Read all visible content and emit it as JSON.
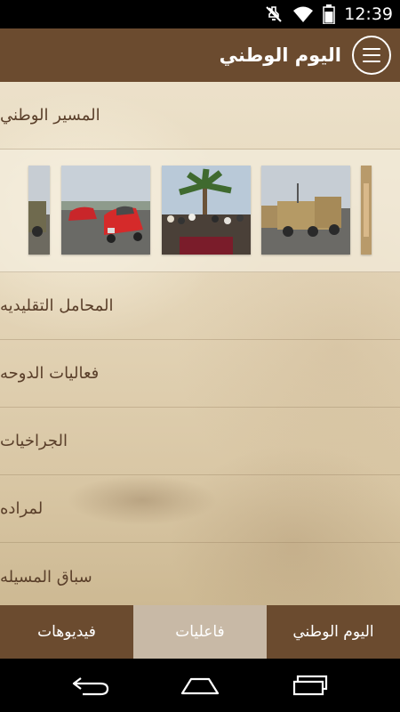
{
  "status_bar": {
    "time": "12:39",
    "icons": [
      "mute-icon",
      "wifi-icon",
      "battery-icon"
    ]
  },
  "app_bar": {
    "title": "اليوم الوطني",
    "menu_icon": "hamburger-menu-icon"
  },
  "list": {
    "items": [
      {
        "label": "المسير الوطني"
      },
      {
        "label": "المحامل التقليديه"
      },
      {
        "label": "فعاليات الدوحه"
      },
      {
        "label": "الجراخيات"
      },
      {
        "label": "لمراده"
      },
      {
        "label": "سباق المسيله"
      }
    ]
  },
  "gallery": {
    "images": [
      "military-vehicle-photo",
      "red-cars-photo",
      "crowd-palm-photo",
      "parade-vehicles-photo",
      "building-photo"
    ]
  },
  "tabs": [
    {
      "label": "فيديوهات",
      "active": false
    },
    {
      "label": "فاعليات",
      "active": true
    },
    {
      "label": "اليوم الوطني",
      "active": false
    }
  ],
  "nav_bar": {
    "icons": [
      "back-icon",
      "home-icon",
      "recent-apps-icon"
    ]
  },
  "colors": {
    "header": "#6b4b2f",
    "active_tab": "#c8b9a6",
    "list_text": "#5a3f2a"
  }
}
